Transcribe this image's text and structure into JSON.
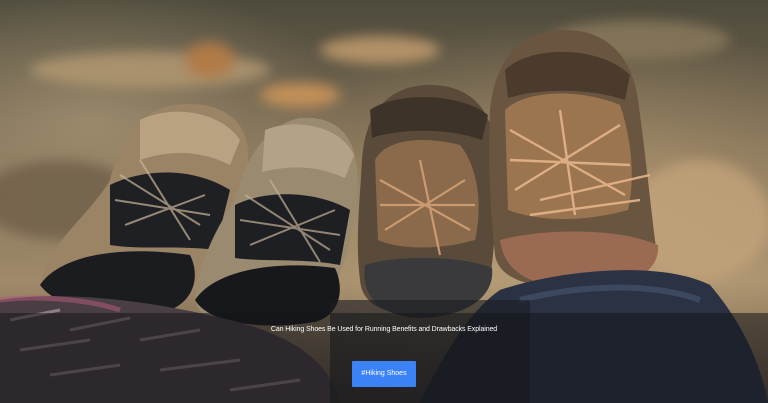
{
  "article": {
    "title": "Can Hiking Shoes Be Used for Running Benefits and Drawbacks Explained",
    "category_label": "Hiking Shoes",
    "category_prefix": "#"
  },
  "image": {
    "subject": "four-hiking-boots-on-crossed-legs",
    "alt": ""
  },
  "colors": {
    "button_bg": "#3b82f6",
    "caption_text": "#ffffff",
    "overlay": "rgba(20,22,26,0.55)"
  }
}
